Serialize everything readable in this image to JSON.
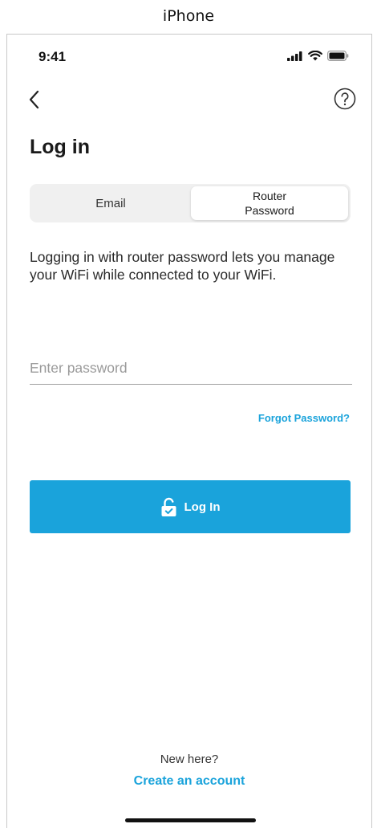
{
  "caption": "iPhone",
  "status_bar": {
    "time": "9:41",
    "icons": [
      "signal-icon",
      "wifi-icon",
      "battery-icon"
    ]
  },
  "nav": {
    "back_icon": "chevron-left-icon",
    "help_icon": "question-circle-icon"
  },
  "title": "Log in",
  "tabs": [
    {
      "label": "Email",
      "selected": false
    },
    {
      "label_line1": "Router",
      "label_line2": "Password",
      "selected": true
    }
  ],
  "description": "Logging in with router password lets you manage your WiFi while connected to your WiFi.",
  "password_field": {
    "placeholder": "Enter password",
    "value": ""
  },
  "forgot_password": "Forgot Password?",
  "login_button": {
    "label": "Log In",
    "icon": "lock-open-icon"
  },
  "footer": {
    "prompt": "New here?",
    "create_account": "Create an account"
  },
  "colors": {
    "accent": "#1aa3db",
    "segment_bg": "#f0f0f0",
    "text": "#1a1a1a"
  }
}
